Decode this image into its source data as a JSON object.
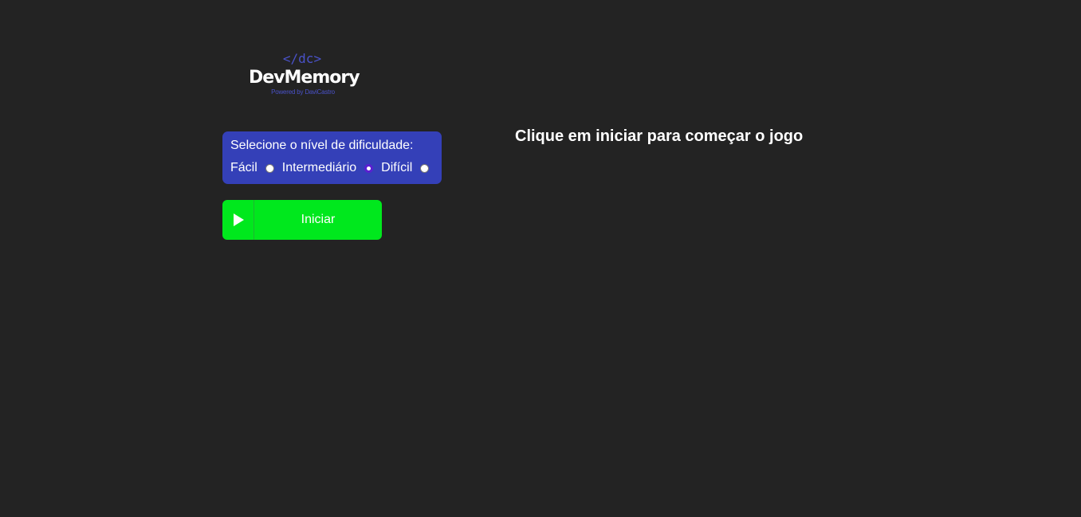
{
  "logo": {
    "mark": "</dc>",
    "title": "DevMemory",
    "subtitle": "Powered by DaviCastro"
  },
  "difficulty": {
    "title": "Selecione o nível de dificuldade:",
    "options": [
      {
        "label": "Fácil",
        "checked": false
      },
      {
        "label": "Intermediário",
        "checked": true
      },
      {
        "label": "Difícil",
        "checked": false
      }
    ]
  },
  "start_button": {
    "label": "Iniciar",
    "icon": "play-icon"
  },
  "message": "Clique em iniciar para começar o jogo",
  "colors": {
    "background": "#232323",
    "difficulty_box": "#3440b8",
    "start_button": "#00e81d",
    "logo_accent": "#4a52c9"
  }
}
